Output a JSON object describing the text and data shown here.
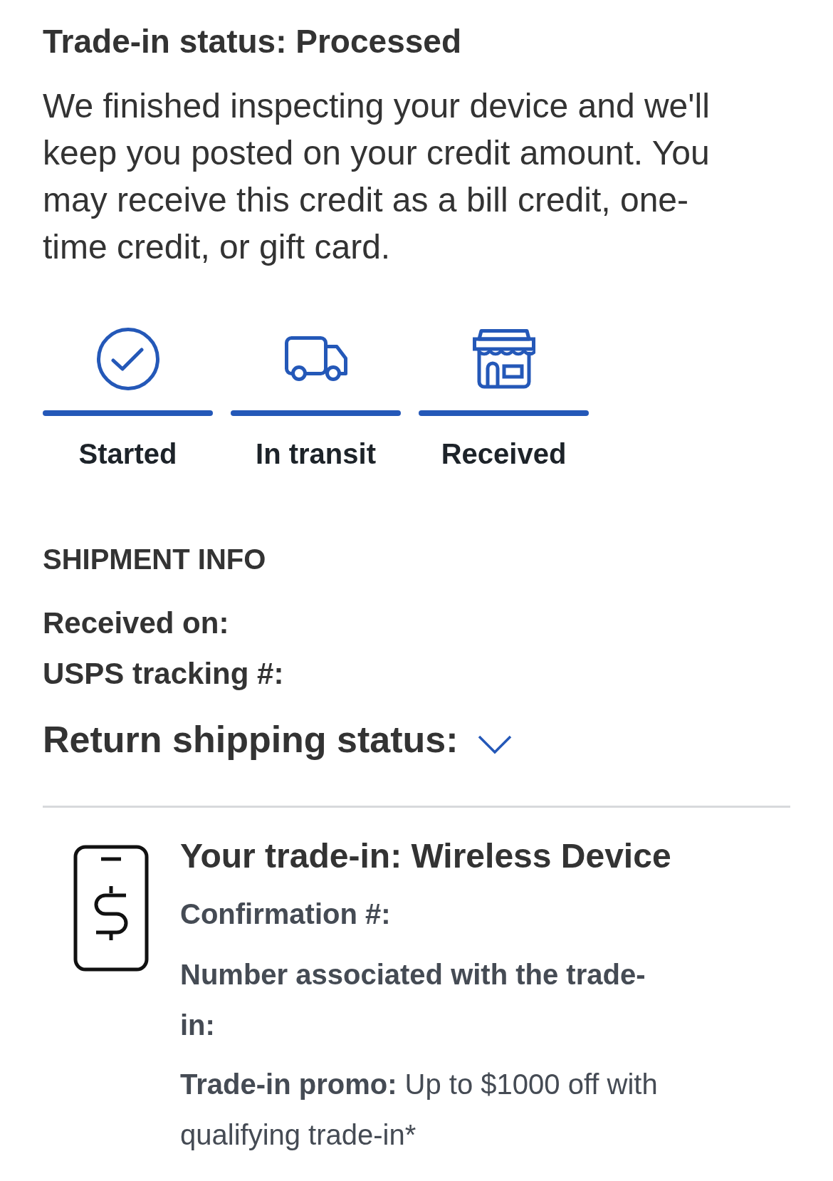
{
  "status": {
    "title": "Trade-in status: Processed",
    "message": "We finished inspecting your device and we'll keep you posted on your credit amount. You may receive this credit as a bill credit, one-time credit, or gift card."
  },
  "progress": [
    {
      "kind": "started",
      "label": "Started",
      "completed": true
    },
    {
      "kind": "transit",
      "label": "In transit",
      "completed": true
    },
    {
      "kind": "received",
      "label": "Received",
      "completed": true
    }
  ],
  "shipment_info": {
    "heading": "SHIPMENT INFO",
    "rows": [
      {
        "label": "Received on:"
      },
      {
        "label": "USPS tracking #:"
      }
    ]
  },
  "return_shipping": {
    "label": "Return shipping status:",
    "expanded": false
  },
  "trade_in": {
    "title": "Your trade-in: Wireless Device",
    "details": [
      "Confirmation #:",
      "Number associated with the trade-in:"
    ],
    "promo": "**Trade-in promo:** Up to $1000 off with qualifying trade-in*"
  }
}
